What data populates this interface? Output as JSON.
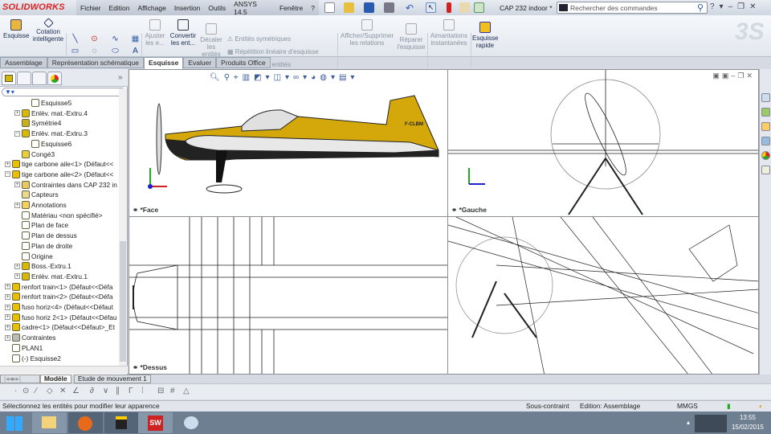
{
  "app": {
    "logo": "SOLIDWORKS",
    "document_title": "CAP 232 indoor *"
  },
  "menu": [
    "Fichier",
    "Edition",
    "Affichage",
    "Insertion",
    "Outils",
    "ANSYS 14.5",
    "Fenêtre",
    "?"
  ],
  "search": {
    "placeholder": "Rechercher des commandes"
  },
  "ribbon": {
    "esquisse": "Esquisse",
    "cotation": "Cotation intelligente",
    "ajuster": "Ajuster les e...",
    "convertir": "Convertir les ent...",
    "decaler": "Décaler les entités",
    "symetriques": "Entités symétriques",
    "repetition": "Répétition linéaire d'esquisse",
    "deplacer": "Déplacer les entités",
    "relations": "Afficher/Supprimer les relations",
    "reparer": "Réparer l'esquisse",
    "aimantations": "Aimantations instantanées",
    "rapide": "Esquisse rapide"
  },
  "tabs": [
    {
      "label": "Assemblage"
    },
    {
      "label": "Représentation schématique"
    },
    {
      "label": "Esquisse",
      "active": true
    },
    {
      "label": "Evaluer"
    },
    {
      "label": "Produits Office"
    }
  ],
  "tree": [
    {
      "label": "Esquisse5",
      "indent": 4,
      "pm": "",
      "icon": "sketch-icon"
    },
    {
      "label": "Enlèv. mat.-Extru.4",
      "indent": 2,
      "pm": "+",
      "icon": "cut-extrude-icon"
    },
    {
      "label": "Symétrie4",
      "indent": 2,
      "pm": "",
      "icon": "mirror-icon"
    },
    {
      "label": "Enlèv. mat.-Extru.3",
      "indent": 2,
      "pm": "−",
      "icon": "cut-extrude-icon"
    },
    {
      "label": "Esquisse6",
      "indent": 4,
      "pm": "",
      "icon": "sketch-icon"
    },
    {
      "label": "Congé3",
      "indent": 2,
      "pm": "",
      "icon": "fillet-icon"
    },
    {
      "label": "tige carbone aile<1> (Défaut<<",
      "indent": 0,
      "pm": "+",
      "icon": "part-icon"
    },
    {
      "label": "tige carbone aile<2> (Défaut<<",
      "indent": 0,
      "pm": "−",
      "icon": "part-icon"
    },
    {
      "label": "Contraintes dans CAP 232 in",
      "indent": 2,
      "pm": "+",
      "icon": "mates-folder-icon"
    },
    {
      "label": "Capteurs",
      "indent": 2,
      "pm": "",
      "icon": "sensors-icon"
    },
    {
      "label": "Annotations",
      "indent": 2,
      "pm": "+",
      "icon": "annotations-icon"
    },
    {
      "label": "Matériau <non spécifié>",
      "indent": 2,
      "pm": "",
      "icon": "material-icon"
    },
    {
      "label": "Plan de face",
      "indent": 2,
      "pm": "",
      "icon": "plane-icon"
    },
    {
      "label": "Plan de dessus",
      "indent": 2,
      "pm": "",
      "icon": "plane-icon"
    },
    {
      "label": "Plan de droite",
      "indent": 2,
      "pm": "",
      "icon": "plane-icon"
    },
    {
      "label": "Origine",
      "indent": 2,
      "pm": "",
      "icon": "origin-icon"
    },
    {
      "label": "Boss.-Extru.1",
      "indent": 2,
      "pm": "+",
      "icon": "boss-extrude-icon"
    },
    {
      "label": "Enlèv. mat.-Extru.1",
      "indent": 2,
      "pm": "+",
      "icon": "cut-extrude-icon"
    },
    {
      "label": "renfort train<1> (Défaut<<Défa",
      "indent": 0,
      "pm": "+",
      "icon": "part-icon"
    },
    {
      "label": "renfort train<2> (Défaut<<Défa",
      "indent": 0,
      "pm": "+",
      "icon": "part-icon"
    },
    {
      "label": "fuso horiz<4> (Défaut<<Défaut",
      "indent": 0,
      "pm": "+",
      "icon": "part-icon"
    },
    {
      "label": "fuso horiz 2<1> (Défaut<<Défau",
      "indent": 0,
      "pm": "+",
      "icon": "part-icon"
    },
    {
      "label": "cadre<1> (Défaut<<Défaut>_Et",
      "indent": 0,
      "pm": "+",
      "icon": "part-icon"
    },
    {
      "label": "Contraintes",
      "indent": 0,
      "pm": "+",
      "icon": "mates-icon"
    },
    {
      "label": "PLAN1",
      "indent": 0,
      "pm": "",
      "icon": "plane-icon"
    },
    {
      "label": "(-) Esquisse2",
      "indent": 0,
      "pm": "",
      "icon": "sketch-icon"
    }
  ],
  "bottom_tabs": {
    "model": "Modèle",
    "motion": "Etude de mouvement 1"
  },
  "viewports": {
    "front": "*Face",
    "left": "*Gauche",
    "top": "*Dessus"
  },
  "aircraft": {
    "registration": "F-CLBM"
  },
  "status": {
    "message": "Sélectionnez les entités pour modifier leur apparence",
    "constraint": "Sous-contraint",
    "edition": "Edition: Assemblage",
    "units": "MMGS"
  },
  "clock": {
    "time": "13:55",
    "date": "15/02/2015"
  },
  "colors": {
    "accent": "#d4a80a",
    "logo": "#d22222"
  }
}
